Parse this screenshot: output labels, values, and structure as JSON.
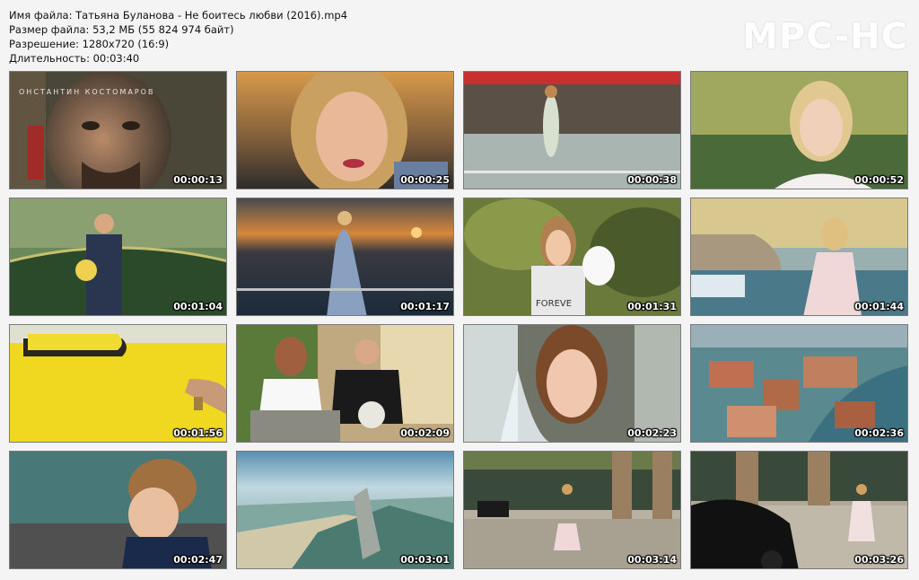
{
  "header": {
    "filename_line": "Имя файла: Татьяна Буланова - Не боитесь любви (2016).mp4",
    "filesize_line": "Размер файла: 53,2 МБ (55 824 974 байт)",
    "resolution_line": "Разрешение: 1280x720 (16:9)",
    "duration_line": "Длительность: 00:03:40"
  },
  "logo": "MPC-HC",
  "first_frame_caption": "ОНСТАНТИН  КОСТОМАРОВ",
  "thumbnails": [
    {
      "time": "00:00:13"
    },
    {
      "time": "00:00:25"
    },
    {
      "time": "00:00:38"
    },
    {
      "time": "00:00:52"
    },
    {
      "time": "00:01:04"
    },
    {
      "time": "00:01:17"
    },
    {
      "time": "00:01:31"
    },
    {
      "time": "00:01:44"
    },
    {
      "time": "00:01:56"
    },
    {
      "time": "00:02:09"
    },
    {
      "time": "00:02:23"
    },
    {
      "time": "00:02:36"
    },
    {
      "time": "00:02:47"
    },
    {
      "time": "00:03:01"
    },
    {
      "time": "00:03:14"
    },
    {
      "time": "00:03:26"
    }
  ],
  "shirt_text": "FOREVE",
  "colors": {
    "background": "#f4f4f4",
    "border": "#7a7a7a",
    "timestamp_text": "#ffffff"
  }
}
